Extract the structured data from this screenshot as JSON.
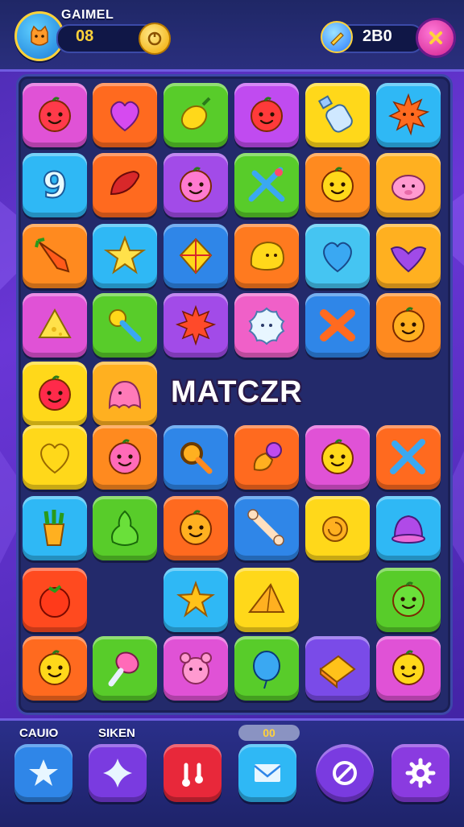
{
  "header": {
    "title": "GAIMEL",
    "score": "08",
    "gems": "2B0"
  },
  "board": {
    "label": "MATCZR",
    "tiles": [
      {
        "color": "#e052d6",
        "icon": "cherry-icon"
      },
      {
        "color": "#ff6a1f",
        "icon": "heart-icon"
      },
      {
        "color": "#58cc2a",
        "icon": "lemon-icon"
      },
      {
        "color": "#c04bf0",
        "icon": "apple-face-icon"
      },
      {
        "color": "#ffd81a",
        "icon": "bottle-icon"
      },
      {
        "color": "#2fb8f5",
        "icon": "sun-icon"
      },
      {
        "color": "#2fb8f5",
        "icon": "nine-icon"
      },
      {
        "color": "#ff6a1f",
        "icon": "chili-icon"
      },
      {
        "color": "#a24be8",
        "icon": "onion-face-icon"
      },
      {
        "color": "#58cc2a",
        "icon": "scissors-icon"
      },
      {
        "color": "#ff8a1f",
        "icon": "orange-face-icon"
      },
      {
        "color": "#ffb020",
        "icon": "pig-icon"
      },
      {
        "color": "#ff8a1f",
        "icon": "carrot-icon"
      },
      {
        "color": "#2fb8f5",
        "icon": "star-icon"
      },
      {
        "color": "#2f86e8",
        "icon": "kite-icon"
      },
      {
        "color": "#ff7a1f",
        "icon": "blob-face-icon"
      },
      {
        "color": "#45c5f2",
        "icon": "blue-heart-icon"
      },
      {
        "color": "#ffb020",
        "icon": "bat-icon"
      },
      {
        "color": "#e052d6",
        "icon": "cheese-icon"
      },
      {
        "color": "#58cc2a",
        "icon": "rattle-icon"
      },
      {
        "color": "#a24be8",
        "icon": "gear-star-icon"
      },
      {
        "color": "#f060c8",
        "icon": "snowflake-icon"
      },
      {
        "color": "#2f86e8",
        "icon": "cross-icon"
      },
      {
        "color": "#ff8a1f",
        "icon": "smile-face-icon"
      },
      {
        "color": "#ffd81a",
        "icon": "berry-face-icon"
      },
      {
        "color": "#ffb020",
        "icon": "ghost-icon"
      },
      {
        "color": "#ffd81a",
        "icon": "yellow-heart-icon"
      },
      {
        "color": "#ff8a1f",
        "icon": "plum-face-icon"
      },
      {
        "color": "#2f86e8",
        "icon": "magnifier-icon"
      },
      {
        "color": "#ff6a1f",
        "icon": "torch-icon"
      },
      {
        "color": "#e052d6",
        "icon": "lemon-face-icon"
      },
      {
        "color": "#ff6a1f",
        "icon": "crossed-swords-icon"
      },
      {
        "color": "#2fb8f5",
        "icon": "fries-icon"
      },
      {
        "color": "#58cc2a",
        "icon": "pear-icon"
      },
      {
        "color": "#ff6a1f",
        "icon": "peach-face-icon"
      },
      {
        "color": "#2f86e8",
        "icon": "bone-icon"
      },
      {
        "color": "#ffd81a",
        "icon": "snail-icon"
      },
      {
        "color": "#2fb8f5",
        "icon": "bell-icon"
      },
      {
        "color": "#ff4a1f",
        "icon": "tomato-icon"
      },
      {
        "color": "#2fb8f5",
        "icon": "yellow-star-icon"
      },
      {
        "color": "#ffd81a",
        "icon": "pyramid-icon"
      },
      {
        "color": "#58cc2a",
        "icon": "green-face-icon"
      },
      {
        "color": "#ff6a1f",
        "icon": "lime-face-icon"
      },
      {
        "color": "#58cc2a",
        "icon": "popsicle-icon"
      },
      {
        "color": "#e052d6",
        "icon": "bear-icon"
      },
      {
        "color": "#58cc2a",
        "icon": "balloon-icon"
      },
      {
        "color": "#7a4be8",
        "icon": "cake-icon"
      },
      {
        "color": "#e052d6",
        "icon": "sprout-face-icon"
      }
    ]
  },
  "footer": {
    "label_left": "CAUIO",
    "label_second": "SIKEN",
    "pill": "00",
    "buttons": [
      {
        "color": "#2f86e8",
        "icon": "star-icon"
      },
      {
        "color": "#7a3be0",
        "icon": "sparkle-icon"
      },
      {
        "color": "#e8283a",
        "icon": "music-icon"
      },
      {
        "color": "#2fb8f5",
        "icon": "mail-icon"
      },
      {
        "color": "#7a3be0",
        "icon": "no-icon"
      },
      {
        "color": "#8a3be0",
        "icon": "gear-icon"
      }
    ]
  }
}
